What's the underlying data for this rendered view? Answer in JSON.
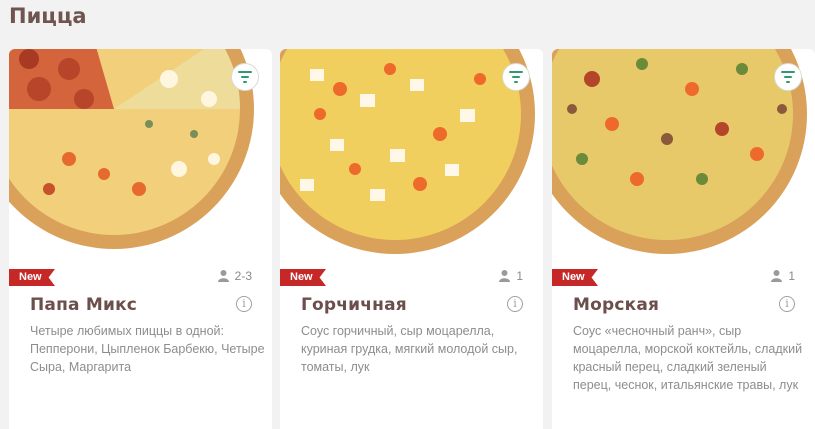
{
  "section": {
    "title": "Пицца"
  },
  "colors": {
    "badge": "#c62828",
    "title": "#70544f",
    "accent_green": "#2e9b6e"
  },
  "cards": [
    {
      "badge": "New",
      "persons": "2-3",
      "name": "Папа Микс",
      "description": "Четыре любимых пиццы в одной: Пепперони, Цыпленок Барбекю, Четыре Сыра, Маргарита",
      "icons": {
        "filter": "filter-icon",
        "person": "person-icon",
        "info": "info-icon"
      }
    },
    {
      "badge": "New",
      "persons": "1",
      "name": "Горчичная",
      "description": "Соус горчичный, сыр моцарелла, куриная грудка, мягкий молодой сыр, томаты, лук",
      "icons": {
        "filter": "filter-icon",
        "person": "person-icon",
        "info": "info-icon"
      }
    },
    {
      "badge": "New",
      "persons": "1",
      "name": "Морская",
      "description": "Соус «чесночный ранч», сыр моцарелла, морской коктейль, сладкий красный перец, сладкий зеленый перец, чеснок, итальянские травы, лук",
      "icons": {
        "filter": "filter-icon",
        "person": "person-icon",
        "info": "info-icon"
      }
    }
  ]
}
